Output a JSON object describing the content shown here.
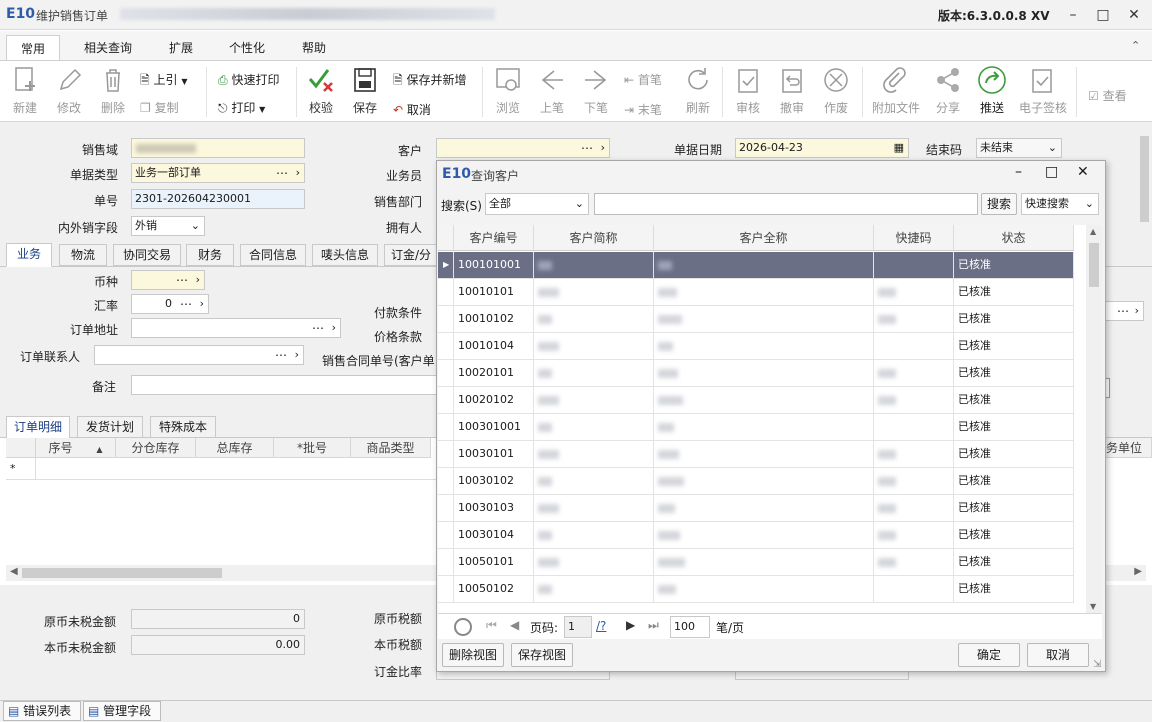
{
  "window": {
    "logo": "E10",
    "title": "维护销售订单",
    "version": "版本:6.3.0.0.8 XV"
  },
  "ribbon_tabs": [
    "常用",
    "相关查询",
    "扩展",
    "个性化",
    "帮助"
  ],
  "ribbon": {
    "new": "新建",
    "edit": "修改",
    "delete": "删除",
    "import_prev": "上引",
    "copy": "复制",
    "quick_print": "快速打印",
    "print": "打印",
    "check": "校验",
    "save": "保存",
    "save_new": "保存并新增",
    "cancel": "取消",
    "browse": "浏览",
    "prev": "上笔",
    "next": "下笔",
    "first": "首笔",
    "last": "末笔",
    "refresh": "刷新",
    "audit": "审核",
    "unaudit": "撤审",
    "void": "作废",
    "attach": "附加文件",
    "share": "分享",
    "push": "推送",
    "esign": "电子签核",
    "view": "查看"
  },
  "form": {
    "sales_domain_label": "销售域",
    "doc_type_label": "单据类型",
    "doc_type_value": "业务一部订单",
    "doc_no_label": "单号",
    "doc_no_value": "2301-202604230001",
    "inout_label": "内外销字段",
    "inout_value": "外销",
    "customer_label": "客户",
    "salesman_label": "业务员",
    "dept_label": "销售部门",
    "owner_label": "拥有人",
    "date_label": "单据日期",
    "date_value": "2026-04-23",
    "close_label": "结束码",
    "close_value": "未结束"
  },
  "detail_tabs": [
    "业务",
    "物流",
    "协同交易",
    "财务",
    "合同信息",
    "唛头信息",
    "订金/分"
  ],
  "business": {
    "currency_label": "币种",
    "rate_label": "汇率",
    "rate_value": "0",
    "addr_label": "订单地址",
    "contact_label": "订单联系人",
    "note_label": "备注",
    "pay_label": "付款条件",
    "price_label": "价格条款",
    "contract_label": "销售合同单号(客户单"
  },
  "line_tabs": [
    "订单明细",
    "发货计划",
    "特殊成本"
  ],
  "line_grid": {
    "columns": [
      "序号",
      "分仓库存",
      "总库存",
      "*批号",
      "商品类型"
    ],
    "right_col": "务单位",
    "new_row_marker": "*"
  },
  "totals": {
    "orig_untaxed_label": "原币未税金额",
    "orig_untaxed_value": "0",
    "local_untaxed_label": "本币未税金额",
    "local_untaxed_value": "0.00",
    "orig_tax_label": "原币税额",
    "local_tax_label": "本币税额",
    "deposit_label": "订金比率"
  },
  "status_bar": [
    "错误列表",
    "管理字段"
  ],
  "dialog": {
    "logo": "E10",
    "title": "查询客户",
    "search_label": "搜索(S)",
    "search_scope": "全部",
    "search_button": "搜索",
    "quick_search": "快速搜索",
    "columns": [
      "客户编号",
      "客户简称",
      "客户全称",
      "快捷码",
      "状态"
    ],
    "rows": [
      {
        "code": "100101001",
        "status": "已核准",
        "has_quick": false
      },
      {
        "code": "10010101",
        "status": "已核准",
        "has_quick": true
      },
      {
        "code": "10010102",
        "status": "已核准",
        "has_quick": true
      },
      {
        "code": "10010104",
        "status": "已核准",
        "has_quick": false
      },
      {
        "code": "10020101",
        "status": "已核准",
        "has_quick": true
      },
      {
        "code": "10020102",
        "status": "已核准",
        "has_quick": true
      },
      {
        "code": "100301001",
        "status": "已核准",
        "has_quick": false
      },
      {
        "code": "10030101",
        "status": "已核准",
        "has_quick": true
      },
      {
        "code": "10030102",
        "status": "已核准",
        "has_quick": true
      },
      {
        "code": "10030103",
        "status": "已核准",
        "has_quick": true
      },
      {
        "code": "10030104",
        "status": "已核准",
        "has_quick": true
      },
      {
        "code": "10050101",
        "status": "已核准",
        "has_quick": true
      },
      {
        "code": "10050102",
        "status": "已核准",
        "has_quick": false
      }
    ],
    "page_label": "页码:",
    "page_value": "1",
    "page_total": "/?",
    "page_size": "100",
    "per_page": "笔/页",
    "delete_view": "删除视图",
    "save_view": "保存视图",
    "ok": "确定",
    "cancel": "取消"
  },
  "colors": {
    "accent": "#2e5ca8",
    "selected_row": "#6b6f86",
    "required_field": "#fbf8dd",
    "push_icon": "#3a9d3a"
  }
}
